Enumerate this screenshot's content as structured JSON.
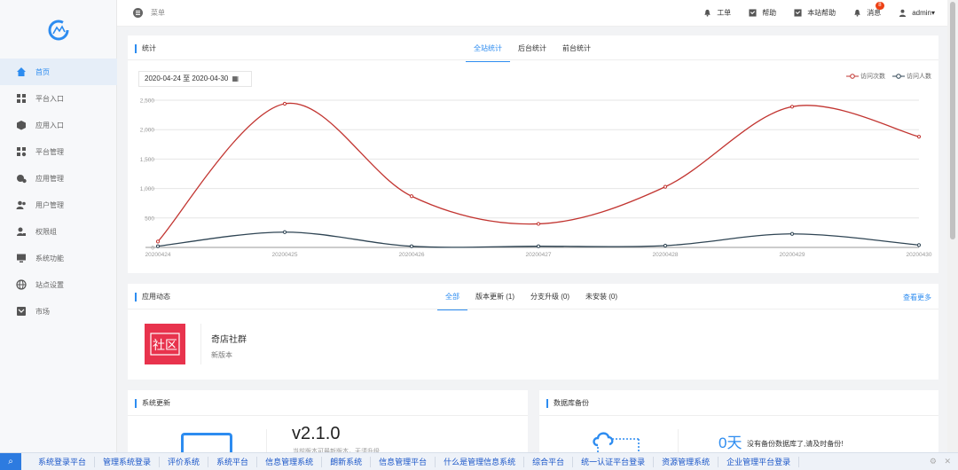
{
  "topbar": {
    "menu_label": "菜单",
    "items": [
      {
        "label": "工单",
        "icon": "bell-icon"
      },
      {
        "label": "帮助",
        "icon": "help-icon"
      },
      {
        "label": "本站帮助",
        "icon": "site-help-icon"
      },
      {
        "label": "消息",
        "icon": "message-icon",
        "badge": "8"
      }
    ],
    "user": "admin▾"
  },
  "sidebar": {
    "items": [
      {
        "label": "首页",
        "icon": "home-icon",
        "active": true
      },
      {
        "label": "平台入口",
        "icon": "grid-icon"
      },
      {
        "label": "应用入口",
        "icon": "cube-icon"
      },
      {
        "label": "平台管理",
        "icon": "grid-settings-icon"
      },
      {
        "label": "应用管理",
        "icon": "app-settings-icon"
      },
      {
        "label": "用户管理",
        "icon": "users-icon"
      },
      {
        "label": "权限组",
        "icon": "user-group-icon"
      },
      {
        "label": "系统功能",
        "icon": "monitor-icon"
      },
      {
        "label": "站点设置",
        "icon": "globe-icon"
      },
      {
        "label": "市场",
        "icon": "market-icon"
      }
    ]
  },
  "stats": {
    "title": "统计",
    "tabs": [
      "全站统计",
      "后台统计",
      "前台统计"
    ],
    "date_range": "2020-04-24 至 2020-04-30",
    "legend": [
      "访问次数",
      "访问人数"
    ]
  },
  "chart_data": {
    "type": "line",
    "x": [
      "20200424",
      "20200425",
      "20200426",
      "20200427",
      "20200428",
      "20200429",
      "20200430"
    ],
    "ylim": [
      0,
      2500
    ],
    "yticks": [
      "0",
      "500",
      "1,000",
      "1,500",
      "2,000",
      "2,500"
    ],
    "grid": true,
    "legend_position": "top-right",
    "series": [
      {
        "name": "访问次数",
        "color": "#c23531",
        "values": [
          100,
          2440,
          870,
          400,
          1030,
          2390,
          1880
        ]
      },
      {
        "name": "访问人数",
        "color": "#2f4554",
        "values": [
          20,
          260,
          20,
          20,
          30,
          230,
          40
        ]
      }
    ]
  },
  "apps": {
    "title": "应用动态",
    "tabs": [
      "全部",
      "版本更新 (1)",
      "分支升级 (0)",
      "未安装 (0)"
    ],
    "more": "查看更多",
    "item": {
      "name": "奇店社群",
      "version_note": "新版本",
      "thumb_text": "社区"
    }
  },
  "update": {
    "title": "系统更新",
    "version": "v2.1.0",
    "note": "当前版本可最新版本，无须升级"
  },
  "backup": {
    "title": "数据库备份",
    "days": "0天",
    "note": "没有备份数据库了,请及时备份!"
  },
  "bottombar": {
    "links": [
      "系统登录平台",
      "管理系统登录",
      "评价系统",
      "系统平台",
      "信息管理系统",
      "朗新系统",
      "信息管理平台",
      "什么是管理信息系统",
      "综合平台",
      "统一认证平台登录",
      "资源管理系统",
      "企业管理平台登录"
    ],
    "close": "✕",
    "settings": "⚙"
  }
}
